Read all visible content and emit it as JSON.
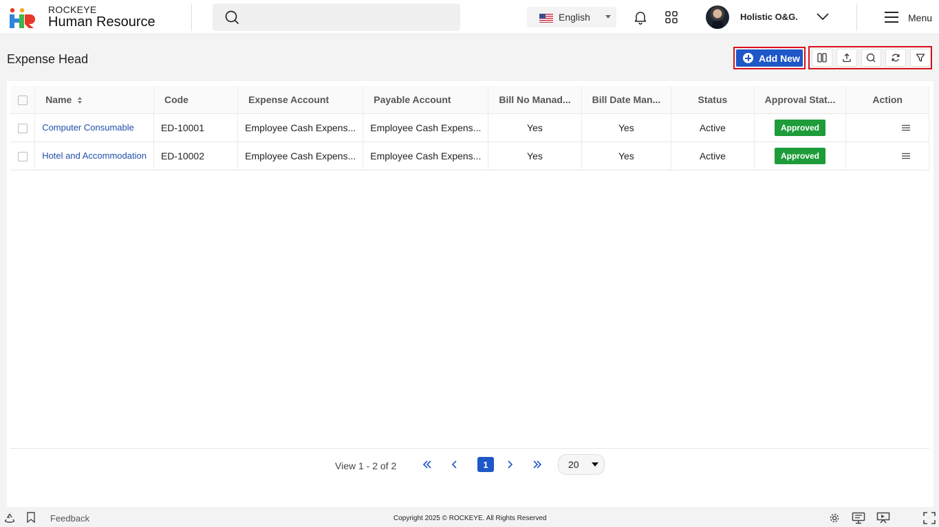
{
  "brand": {
    "top": "ROCKEYE",
    "main": "Human Resource"
  },
  "header": {
    "language": "English",
    "user_name": "Holistic O&G.",
    "menu_label": "Menu"
  },
  "page": {
    "title": "Expense Head",
    "add_new_label": "Add New"
  },
  "table": {
    "headers": {
      "name": "Name",
      "code": "Code",
      "expense_account": "Expense Account",
      "payable_account": "Payable Account",
      "bill_no_mandatory": "Bill No Manad...",
      "bill_date_mandatory": "Bill Date Man...",
      "status": "Status",
      "approval_status": "Approval Stat...",
      "action": "Action"
    },
    "rows": [
      {
        "name": "Computer Consumable",
        "code": "ED-10001",
        "expense_account": "Employee Cash Expens...",
        "payable_account": "Employee Cash Expens...",
        "bill_no_mandatory": "Yes",
        "bill_date_mandatory": "Yes",
        "status": "Active",
        "approval_status": "Approved"
      },
      {
        "name": "Hotel and Accommodation",
        "code": "ED-10002",
        "expense_account": "Employee Cash Expens...",
        "payable_account": "Employee Cash Expens...",
        "bill_no_mandatory": "Yes",
        "bill_date_mandatory": "Yes",
        "status": "Active",
        "approval_status": "Approved"
      }
    ]
  },
  "pagination": {
    "view_text": "View 1 - 2 of 2",
    "current_page": "1",
    "page_size": "20"
  },
  "footer": {
    "feedback": "Feedback",
    "copyright": "Copyright 2025 © ROCKEYE. All Rights Reserved"
  },
  "colors": {
    "primary": "#1e57c8",
    "approved": "#1e9c3a",
    "highlight": "#d9101b"
  }
}
